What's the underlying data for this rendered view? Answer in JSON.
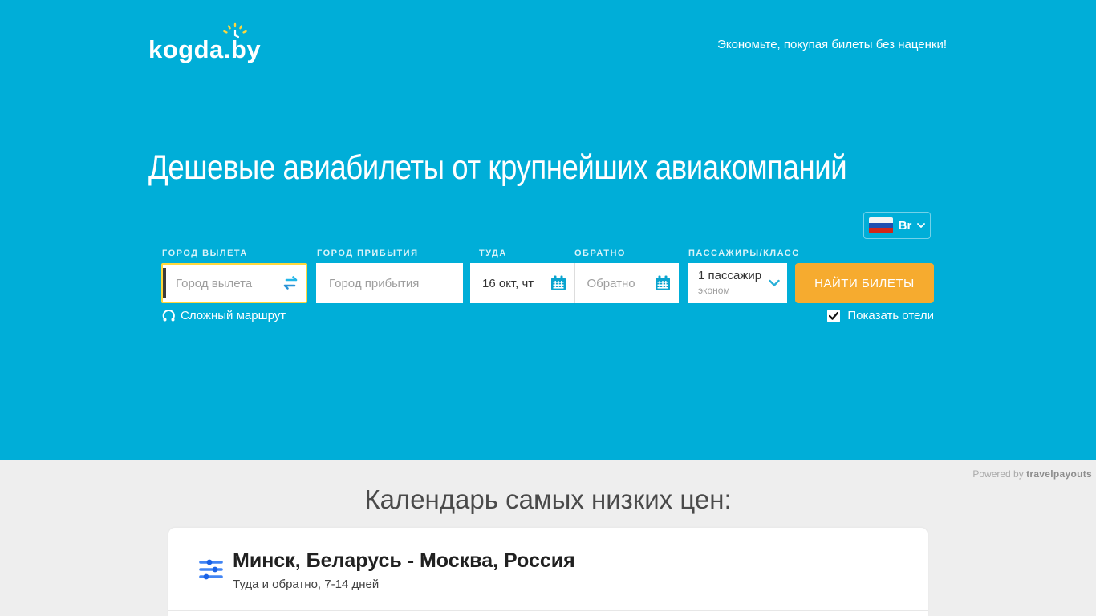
{
  "theme": {
    "accent_cyan": "#00aed8",
    "button_yellow": "#f6ab2f",
    "focus_border_yellow": "#ffd83c",
    "card_icon_blue": "#4285f4",
    "flag_colors": [
      "#f4f4f4",
      "#1f4fb0",
      "#d32619"
    ]
  },
  "header": {
    "logo": "kogda.by",
    "tagline": "Экономьте, покупая билеты без наценки!"
  },
  "hero": {
    "title": "Дешевые авиабилеты от крупнейших авиакомпаний"
  },
  "currency": {
    "selected": "Br",
    "flag": "russia-flag"
  },
  "search_form": {
    "origin": {
      "label": "ГОРОД ВЫЛЕТА",
      "placeholder": "Город вылета",
      "value": ""
    },
    "destination": {
      "label": "ГОРОД ПРИБЫТИЯ",
      "placeholder": "Город прибытия",
      "value": ""
    },
    "depart": {
      "label": "ТУДА",
      "value": "16 окт, чт"
    },
    "return": {
      "label": "ОБРАТНО",
      "placeholder": "Обратно",
      "value": ""
    },
    "passengers": {
      "label": "ПАССАЖИРЫ/КЛАСС",
      "count": "1 пассажир",
      "class": "эконом"
    },
    "submit_label": "НАЙТИ БИЛЕТЫ",
    "complex_route_label": "Сложный маршрут",
    "show_hotels": {
      "label": "Показать отели",
      "checked": true
    }
  },
  "icons": {
    "swap": "⇄",
    "calendar": "📅",
    "chevron_down": "▾",
    "complex_route": "♻",
    "check": "✔",
    "sliders": "☰",
    "clock_decor": "🕐"
  },
  "lower": {
    "powered_by": "Powered by ",
    "powered_brand": "travelpayouts",
    "section_title": "Календарь самых низких цен:",
    "card": {
      "route": "Минск, Беларусь - Москва, Россия",
      "details": "Туда и обратно, 7-14 дней"
    }
  }
}
